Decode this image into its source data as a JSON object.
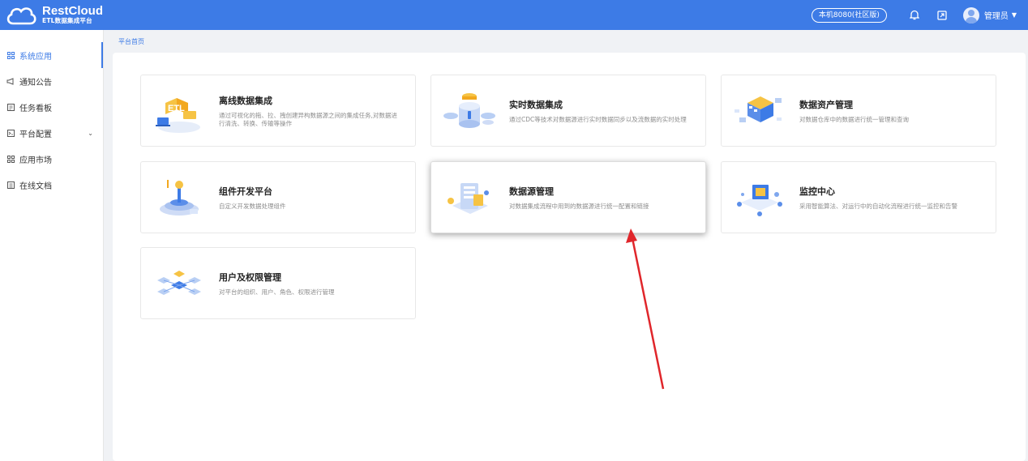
{
  "header": {
    "logo_title": "RestCloud",
    "logo_subtitle": "ETL数据集成平台",
    "env_label": "本机8080(社区版)",
    "user_name": "管理员",
    "icons": [
      "bell-icon",
      "export-icon",
      "avatar",
      "caret-down-icon"
    ],
    "accent_color": "#3d7be6"
  },
  "sidebar": {
    "items": [
      {
        "label": "系统应用",
        "icon": "grid-icon",
        "active": true
      },
      {
        "label": "通知公告",
        "icon": "megaphone-icon"
      },
      {
        "label": "任务看板",
        "icon": "board-icon"
      },
      {
        "label": "平台配置",
        "icon": "config-icon",
        "expandable": true
      },
      {
        "label": "应用市场",
        "icon": "grid-icon"
      },
      {
        "label": "在线文档",
        "icon": "document-icon"
      }
    ]
  },
  "breadcrumb": "平台首页",
  "cards": [
    {
      "title": "离线数据集成",
      "desc": "通过可视化的拖、拉、拽创建异构数据源之间的集成任务,对数据进行清洗、转换、传输等操作"
    },
    {
      "title": "实时数据集成",
      "desc": "通过CDC等技术对数据源进行实时数据同步以及流数据的实时处理"
    },
    {
      "title": "数据资产管理",
      "desc": "对数据仓库中的数据进行统一管理和查询"
    },
    {
      "title": "组件开发平台",
      "desc": "自定义开发数据处理组件"
    },
    {
      "title": "数据源管理",
      "desc": "对数据集成流程中用到的数据源进行统一配置和链接"
    },
    {
      "title": "监控中心",
      "desc": "采用智能算法、对运行中的自动化流程进行统一监控和告警"
    },
    {
      "title": "用户及权限管理",
      "desc": "对平台的组织、用户、角色、权限进行管理"
    }
  ],
  "annotation": {
    "color": "#e0262b"
  }
}
